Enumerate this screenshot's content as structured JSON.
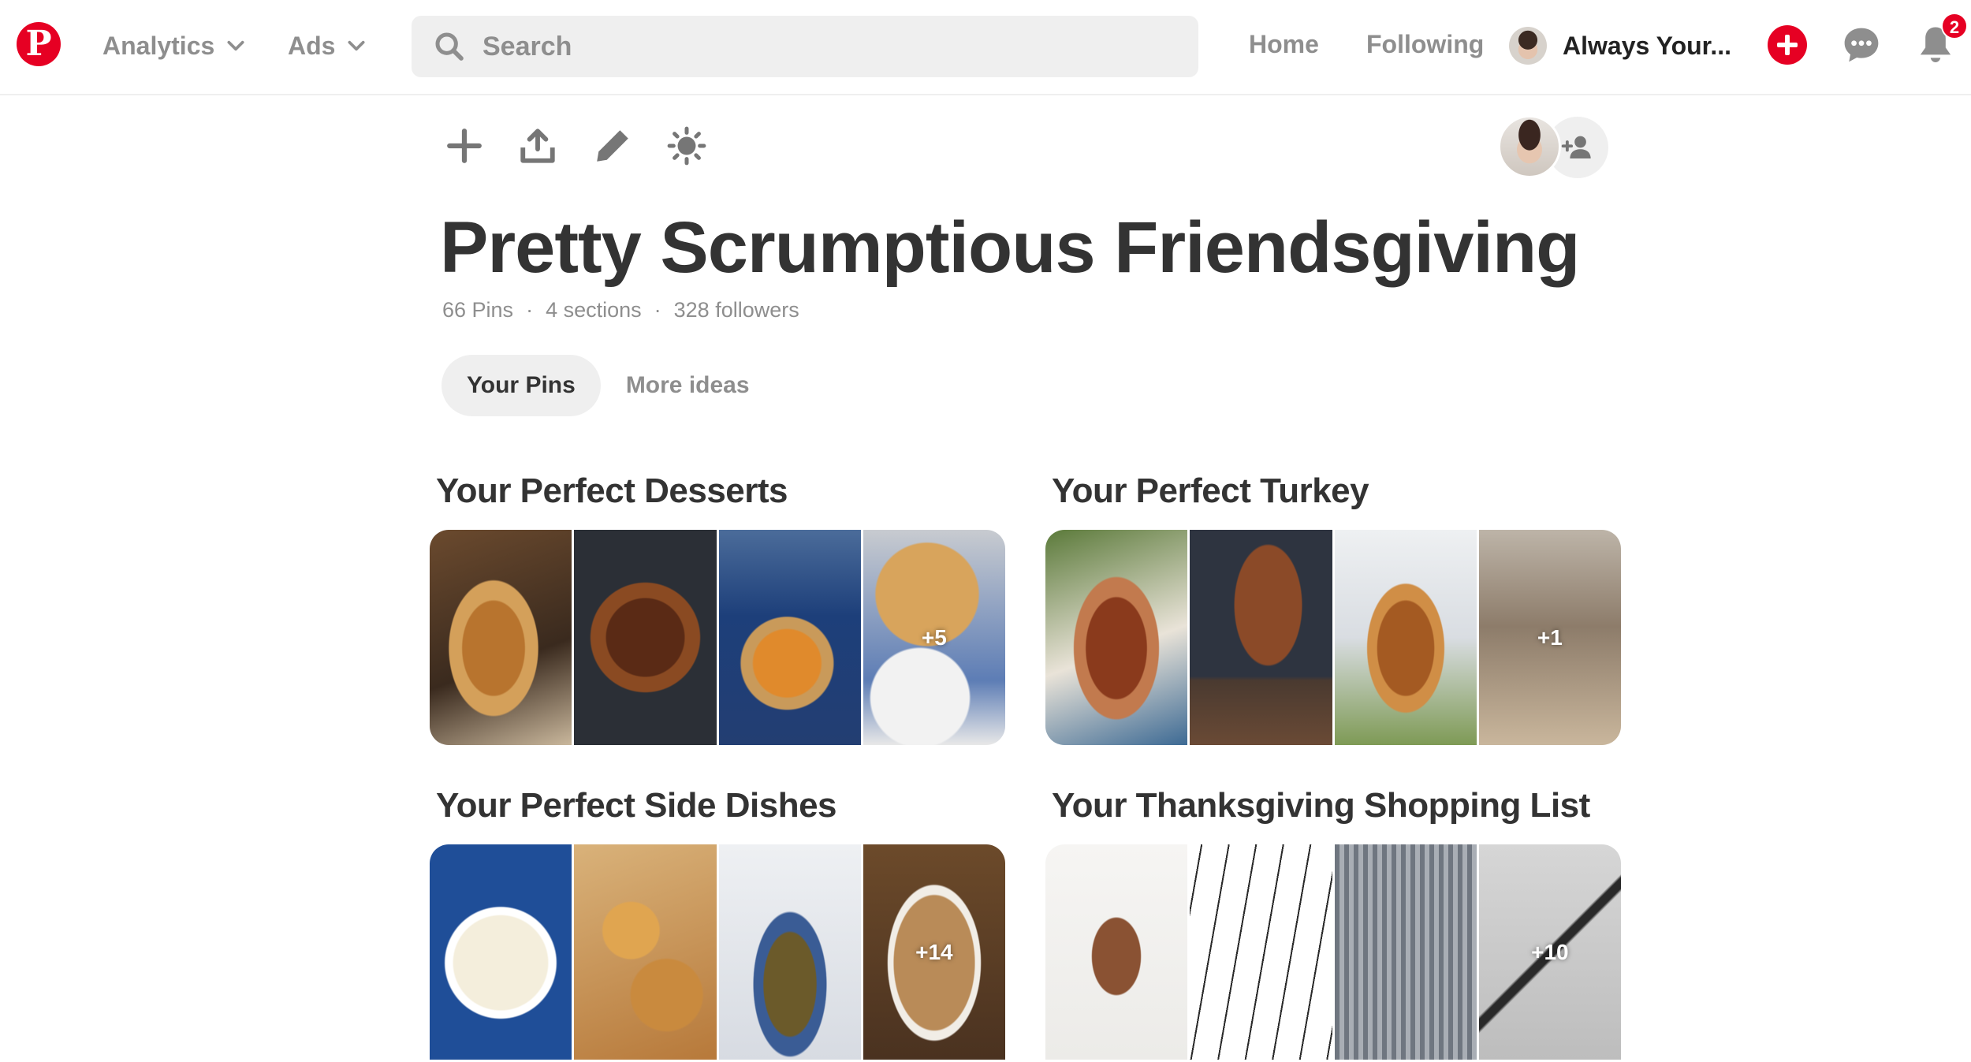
{
  "header": {
    "logo": "P",
    "analytics_label": "Analytics",
    "ads_label": "Ads",
    "search_placeholder": "Search",
    "home_label": "Home",
    "following_label": "Following",
    "profile_name": "Always Your...",
    "notification_count": "2"
  },
  "board": {
    "title": "Pretty Scrumptious Friendsgiving",
    "pins": "66 Pins",
    "sections": "4 sections",
    "followers": "328 followers",
    "separator": "·"
  },
  "tabs": [
    {
      "label": "Your Pins",
      "active": true
    },
    {
      "label": "More ideas",
      "active": false
    }
  ],
  "sections": [
    {
      "title": "Your Perfect Desserts",
      "more": "+5"
    },
    {
      "title": "Your Perfect Turkey",
      "more": "+1"
    },
    {
      "title": "Your Perfect Side Dishes",
      "more": "+14"
    },
    {
      "title": "Your Thanksgiving Shopping List",
      "more": "+10"
    }
  ],
  "colors": {
    "brand": "#e60023",
    "muted": "#8e8e8e",
    "text": "#333333",
    "pill": "#efefef"
  }
}
